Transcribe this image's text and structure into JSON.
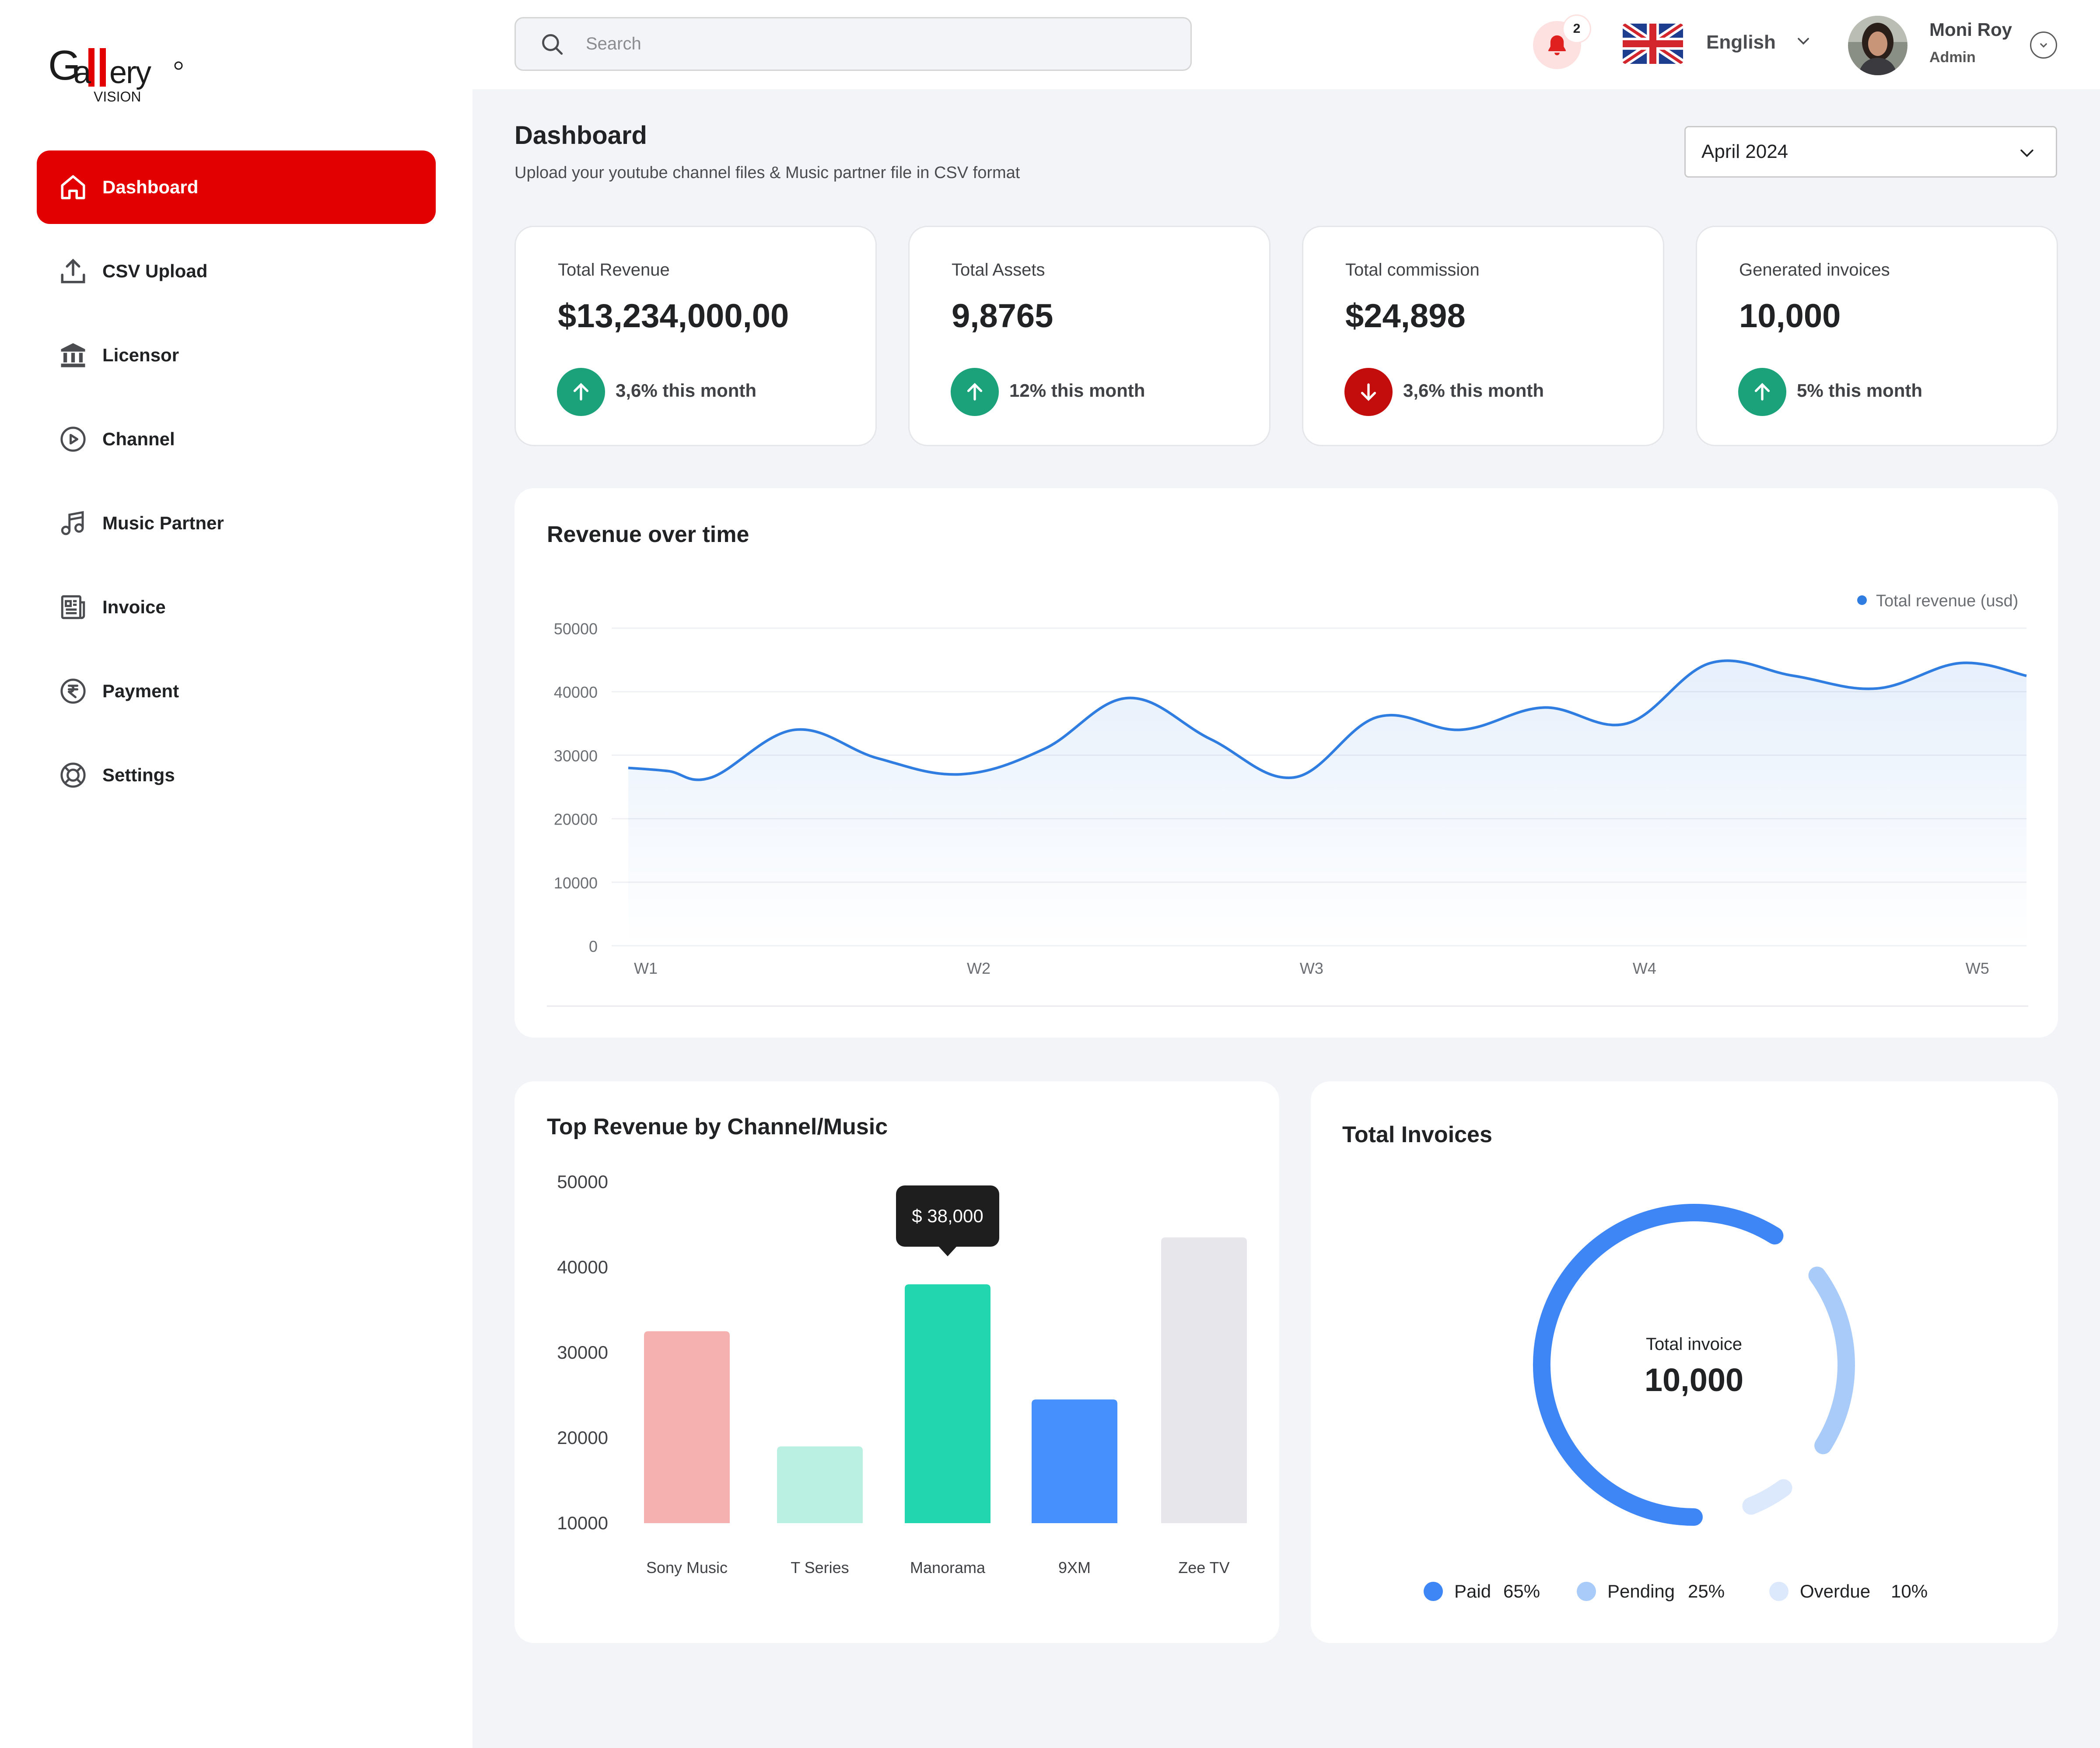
{
  "brand": {
    "logo_text": "Gallery",
    "logo_subtext": "VISION"
  },
  "sidebar": {
    "items": [
      {
        "label": "Dashboard",
        "icon": "home-icon",
        "active": true
      },
      {
        "label": "CSV Upload",
        "icon": "upload-icon"
      },
      {
        "label": "Licensor",
        "icon": "bank-icon"
      },
      {
        "label": "Channel",
        "icon": "play-circle-icon"
      },
      {
        "label": "Music Partner",
        "icon": "music-note-icon"
      },
      {
        "label": "Invoice",
        "icon": "newspaper-icon"
      },
      {
        "label": "Payment",
        "icon": "rupee-icon"
      },
      {
        "label": "Settings",
        "icon": "settings-lifebuoy-icon"
      }
    ]
  },
  "header": {
    "search_placeholder": "Search",
    "notifications_count": "2",
    "language": "English",
    "user": {
      "name": "Moni Roy",
      "role": "Admin"
    }
  },
  "page": {
    "title": "Dashboard",
    "subtitle": "Upload your youtube channel files & Music partner file in CSV format",
    "month": "April 2024"
  },
  "stats": [
    {
      "label": "Total Revenue",
      "value": "$13,234,000,00",
      "change": "3,6% this month",
      "trend": "up"
    },
    {
      "label": "Total Assets",
      "value": "9,8765",
      "change": "12% this month",
      "trend": "up"
    },
    {
      "label": "Total commission",
      "value": "$24,898",
      "change": "3,6% this month",
      "trend": "down"
    },
    {
      "label": "Generated invoices",
      "value": "10,000",
      "change": "5% this month",
      "trend": "up"
    }
  ],
  "colors": {
    "brand_red": "#e30000",
    "trend_up": "#1ba27a",
    "trend_down": "#c30d0d",
    "line": "#2f7de1"
  },
  "chart_data": [
    {
      "type": "area",
      "title": "Revenue over time",
      "legend": [
        "Total revenue (usd)"
      ],
      "legend_position": "top-right",
      "x_ticks": [
        "W1",
        "W2",
        "W3",
        "W4",
        "W5"
      ],
      "y_ticks": [
        "0",
        "10000",
        "20000",
        "30000",
        "40000",
        "50000"
      ],
      "ylim": [
        0,
        50000
      ],
      "grid": true,
      "series": [
        {
          "name": "Total revenue (usd)",
          "x": [
            1.0,
            1.12,
            1.25,
            1.5,
            1.75,
            2.0,
            2.25,
            2.5,
            2.75,
            3.0,
            3.25,
            3.5,
            3.75,
            4.0,
            4.25,
            4.5,
            4.75,
            5.0,
            5.2
          ],
          "y": [
            28000,
            27500,
            26500,
            34000,
            29500,
            27000,
            31000,
            39000,
            32500,
            26500,
            36000,
            34000,
            37500,
            35000,
            44500,
            42500,
            40500,
            44500,
            42500
          ]
        }
      ]
    },
    {
      "type": "bar",
      "title": "Top Revenue by Channel/Music",
      "categories": [
        "Sony Music",
        "T Series",
        "Manorama",
        "9XM",
        "Zee TV"
      ],
      "values": [
        32500,
        19000,
        38000,
        24500,
        43500
      ],
      "colors": [
        "#f5b0b0",
        "#b9f0e2",
        "#22d7b0",
        "#4590fc",
        "#e6e6eb"
      ],
      "y_ticks": [
        "10000",
        "20000",
        "30000",
        "40000",
        "50000"
      ],
      "ylim": [
        10000,
        50000
      ],
      "tooltip": {
        "category": "Manorama",
        "text": "$ 38,000"
      }
    },
    {
      "type": "pie",
      "title": "Total Invoices",
      "center_label": "Total invoice",
      "center_value": "10,000",
      "slices": [
        {
          "label": "Paid",
          "value": 65,
          "value_label": "65%",
          "color": "#3e86f6"
        },
        {
          "label": "Pending",
          "value": 25,
          "value_label": "25%",
          "color": "#a9cbfa"
        },
        {
          "label": "Overdue",
          "value": 10,
          "value_label": "10%",
          "color": "#dce9fc"
        }
      ]
    }
  ]
}
